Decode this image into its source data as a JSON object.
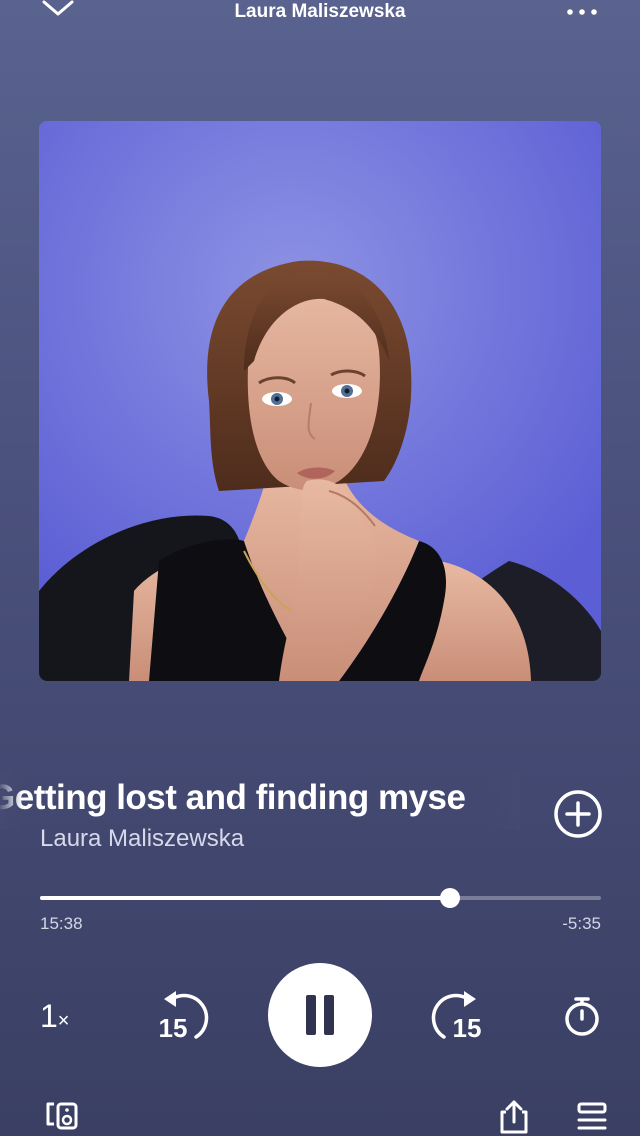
{
  "header": {
    "title": "Laura Maliszewska",
    "collapse_icon": "chevron-down-icon",
    "more_icon": "more-horizontal-icon"
  },
  "artwork": {
    "description_icon": "album-art"
  },
  "track": {
    "title": "Getting lost and finding myse",
    "artist": "Laura Maliszewska"
  },
  "playback": {
    "elapsed": "15:38",
    "remaining": "-5:35",
    "progress_fraction": 0.731,
    "speed_value": "1",
    "speed_suffix": "×",
    "skip_back_seconds": "15",
    "skip_forward_seconds": "15"
  },
  "icons": {
    "add": "add-circle-icon",
    "play_pause": "pause-icon",
    "sleep_timer": "timer-icon",
    "devices": "devices-icon",
    "share": "share-icon",
    "queue": "queue-icon"
  },
  "colors": {
    "background_top": "#5a628f",
    "background_bottom": "#3a3f63",
    "artwork_bg": "#6a70de"
  }
}
